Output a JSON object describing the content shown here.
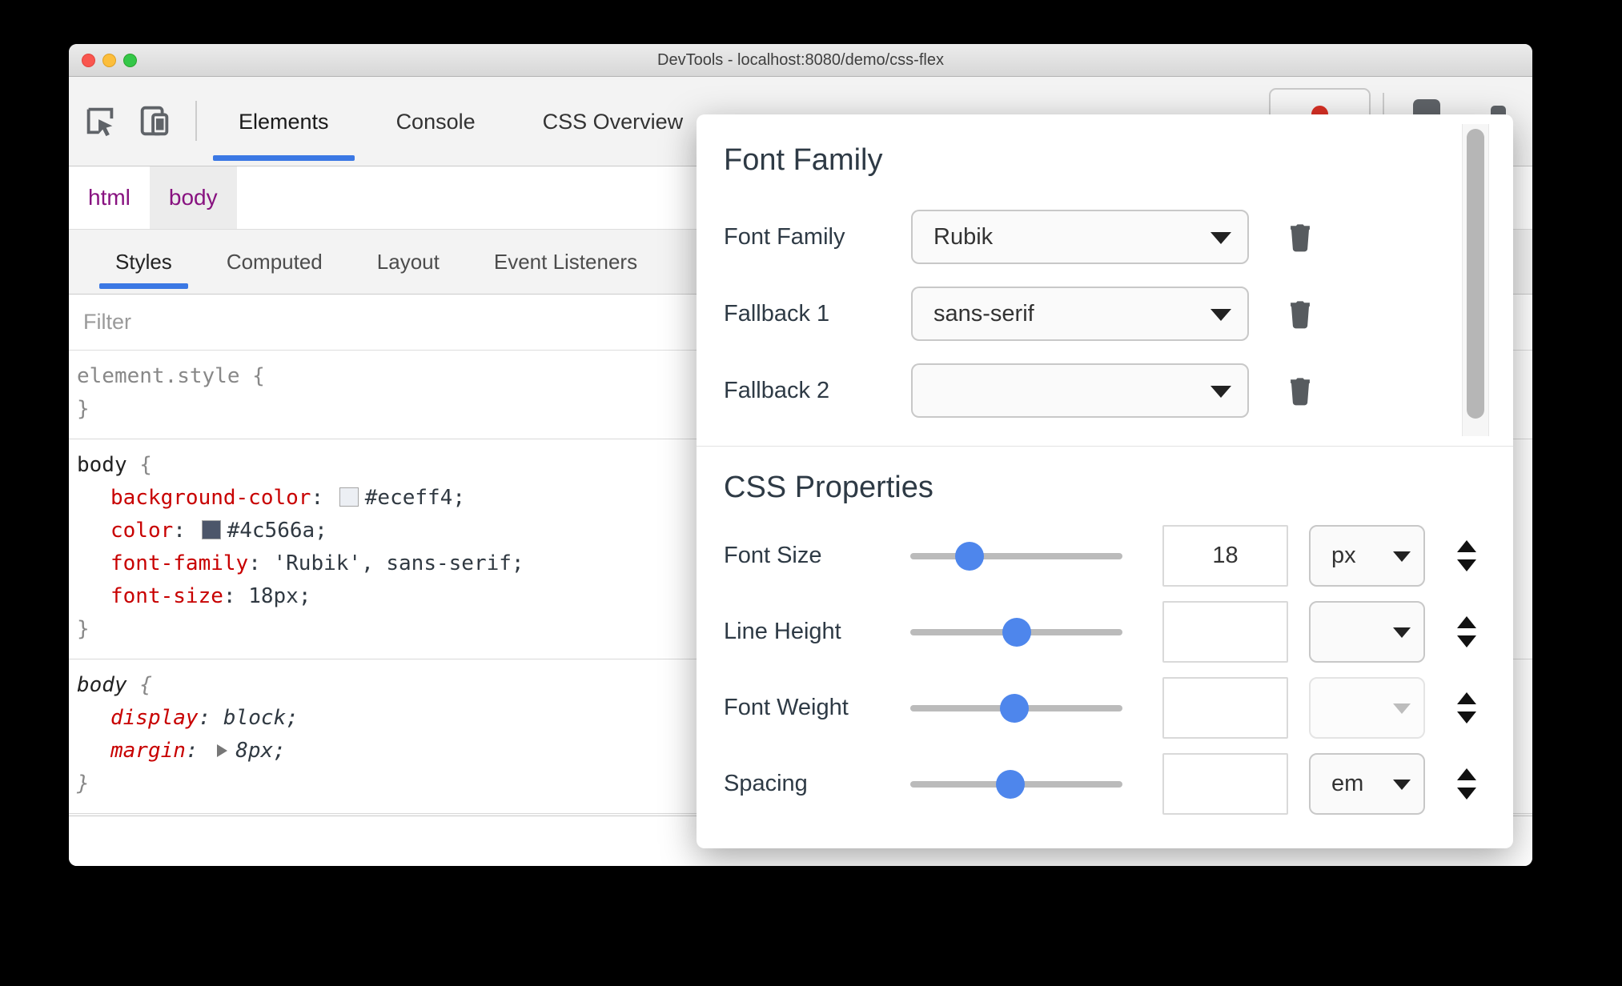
{
  "window": {
    "title": "DevTools - localhost:8080/demo/css-flex",
    "main_tabs": [
      {
        "label": "Elements",
        "active": true
      },
      {
        "label": "Console",
        "active": false
      },
      {
        "label": "CSS Overview",
        "active": false
      }
    ],
    "breadcrumbs": [
      {
        "label": "html",
        "selected": false
      },
      {
        "label": "body",
        "selected": true
      }
    ],
    "sidebar_tabs": [
      {
        "label": "Styles",
        "active": true
      },
      {
        "label": "Computed",
        "active": false
      },
      {
        "label": "Layout",
        "active": false
      },
      {
        "label": "Event Listeners",
        "active": false
      }
    ],
    "filter": {
      "placeholder": "Filter"
    },
    "punct": {
      "colon": ": ",
      "open": "{",
      "close": "}"
    },
    "rules": [
      {
        "selector": "element.style"
      },
      {
        "selector": "body",
        "properties": [
          {
            "name": "background-color",
            "value": "#eceff4;",
            "swatch": "#eceff4"
          },
          {
            "name": "color",
            "value": "#4c566a;",
            "swatch": "#4c566a"
          },
          {
            "name": "font-family",
            "value": "'Rubik', sans-serif;"
          },
          {
            "name": "font-size",
            "value": "18px;"
          }
        ]
      },
      {
        "selector": "body",
        "properties": [
          {
            "name": "display",
            "value": "block;"
          },
          {
            "name": "margin",
            "value": "8px;"
          }
        ]
      }
    ]
  },
  "overlay": {
    "font_family": {
      "title": "Font Family",
      "rows": [
        {
          "label": "Font Family",
          "value": "Rubik"
        },
        {
          "label": "Fallback 1",
          "value": "sans-serif"
        },
        {
          "label": "Fallback 2",
          "value": ""
        }
      ]
    },
    "css_properties": {
      "title": "CSS Properties",
      "rows": [
        {
          "label": "Font Size",
          "value": "18",
          "unit": "px",
          "slider_percent": 28,
          "unit_disabled": false
        },
        {
          "label": "Line Height",
          "value": "",
          "unit": "",
          "slider_percent": 50,
          "unit_disabled": false
        },
        {
          "label": "Font Weight",
          "value": "",
          "unit": "",
          "slider_percent": 49,
          "unit_disabled": true
        },
        {
          "label": "Spacing",
          "value": "",
          "unit": "em",
          "slider_percent": 47,
          "unit_disabled": false
        }
      ]
    }
  },
  "colors": {
    "accent_blue": "#3b78e4",
    "slider_thumb_blue": "#4e86ec",
    "property_red": "#c80000",
    "value_slate": "#303942",
    "breadcrumb_purple": "#881280",
    "background_swatch": "#eceff4",
    "color_swatch": "#4c566a"
  }
}
